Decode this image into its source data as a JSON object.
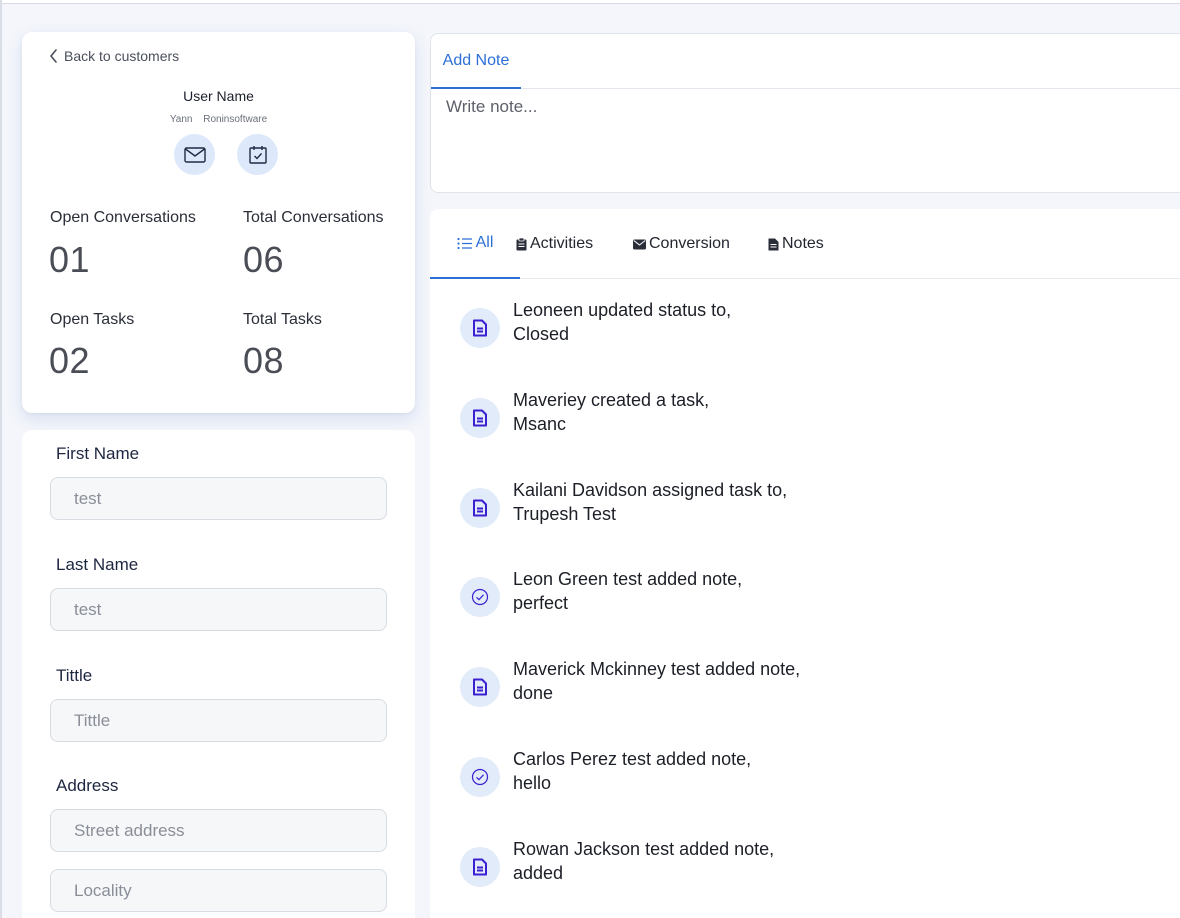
{
  "profile": {
    "back_label": "Back to customers",
    "user_name": "User Name",
    "first": "Yann",
    "company": "Roninsoftware",
    "stats": [
      {
        "label": "Open Conversations",
        "value": "01"
      },
      {
        "label": "Total Conversations",
        "value": "06"
      },
      {
        "label": "Open Tasks",
        "value": "02"
      },
      {
        "label": "Total Tasks",
        "value": "08"
      }
    ]
  },
  "form": {
    "first_name_label": "First Name",
    "first_name_value": "test",
    "last_name_label": "Last Name",
    "last_name_value": "test",
    "title_label": "Tittle",
    "title_placeholder": "Tittle",
    "address_label": "Address",
    "street_placeholder": "Street address",
    "locality_placeholder": "Locality"
  },
  "note": {
    "tab_label": "Add Note",
    "placeholder": "Write note..."
  },
  "tabs": {
    "all": "All",
    "activities": "Activities",
    "conversion": "Conversion",
    "notes": "Notes"
  },
  "feed": [
    {
      "line1": "Leoneen updated status to,",
      "line2": "Closed",
      "icon": "document-icon"
    },
    {
      "line1": "Maveriey created a task,",
      "line2": "Msanc",
      "icon": "document-icon"
    },
    {
      "line1": "Kailani Davidson assigned task to,",
      "line2": "Trupesh Test",
      "icon": "document-icon"
    },
    {
      "line1": "Leon Green test added note,",
      "line2": "perfect",
      "icon": "check-circle-icon"
    },
    {
      "line1": "Maverick Mckinney test added note,",
      "line2": "done",
      "icon": "document-icon"
    },
    {
      "line1": "Carlos Perez test added note,",
      "line2": "hello",
      "icon": "check-circle-icon"
    },
    {
      "line1": "Rowan Jackson test added note,",
      "line2": "added",
      "icon": "document-icon"
    }
  ],
  "colors": {
    "accent": "#2c6fd6",
    "icon_purple": "#3b1fd1",
    "icon_bg": "#e1ebf9"
  }
}
